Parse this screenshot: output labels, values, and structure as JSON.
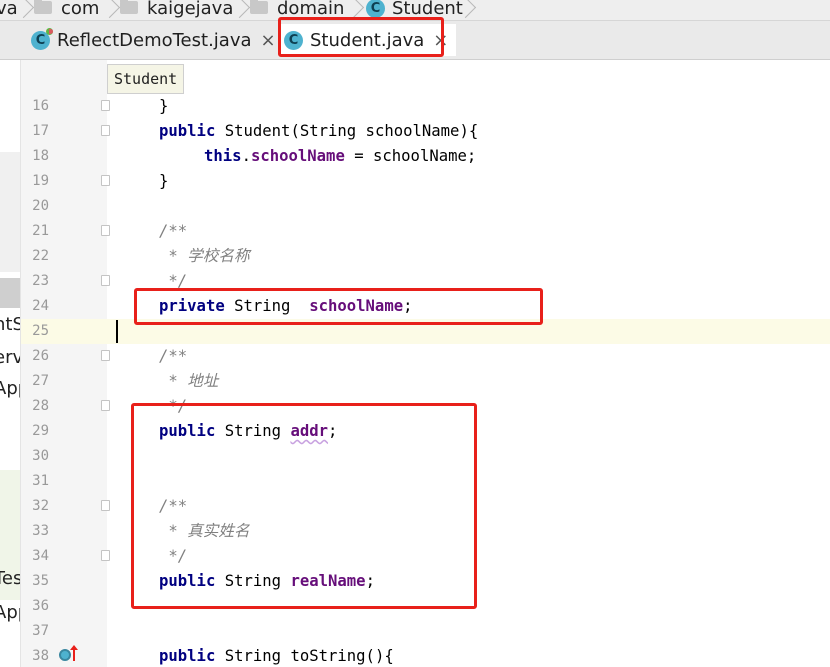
{
  "breadcrumbs": [
    "va",
    "com",
    "kaigejava",
    "domain",
    "Student"
  ],
  "tabs": [
    {
      "label": "ReflectDemoTest.java",
      "close": "×",
      "icon": "class-icon"
    },
    {
      "label": "Student.java",
      "close": "×",
      "icon": "class-icon"
    }
  ],
  "class_icon_letter": "C",
  "breadcrumb_popup": "Student",
  "left_panel_fragments": [
    "ntS",
    "erv",
    "App",
    "Tes",
    "App"
  ],
  "left_panel_arrow": "←",
  "code": {
    "l16": {
      "num": "16",
      "t1": "}"
    },
    "l17": {
      "num": "17",
      "kw": "public",
      "rest": " Student(String schoolName){"
    },
    "l18": {
      "num": "18",
      "kw": "this",
      "dot": ".",
      "fld": "schoolName",
      "rest": " = schoolName;"
    },
    "l19": {
      "num": "19",
      "t1": "}"
    },
    "l20": {
      "num": "20"
    },
    "l21": {
      "num": "21",
      "cmt": "/**"
    },
    "l22": {
      "num": "22",
      "cmt": " * 学校名称"
    },
    "l23": {
      "num": "23",
      "cmt": " */"
    },
    "l24": {
      "num": "24",
      "kw": "private",
      "rest": " String  ",
      "fld": "schoolName",
      "end": ";"
    },
    "l25": {
      "num": "25"
    },
    "l26": {
      "num": "26",
      "cmt": "/**"
    },
    "l27": {
      "num": "27",
      "cmt": " * 地址"
    },
    "l28": {
      "num": "28",
      "cmt": " */"
    },
    "l29": {
      "num": "29",
      "kw": "public",
      "rest": " String ",
      "fld": "addr",
      "end": ";"
    },
    "l30": {
      "num": "30"
    },
    "l31": {
      "num": "31"
    },
    "l32": {
      "num": "32",
      "cmt": "/**"
    },
    "l33": {
      "num": "33",
      "cmt": " * 真实姓名"
    },
    "l34": {
      "num": "34",
      "cmt": " */"
    },
    "l35": {
      "num": "35",
      "kw": "public",
      "rest": " String ",
      "fld": "realName",
      "end": ";"
    },
    "l36": {
      "num": "36"
    },
    "l37": {
      "num": "37"
    },
    "l38": {
      "num": "38",
      "kw": "public",
      "rest": " String toString(){"
    }
  },
  "colors": {
    "highlight": "#e8201a",
    "keyword": "#000080",
    "field": "#660e7a",
    "comment": "#808080"
  }
}
